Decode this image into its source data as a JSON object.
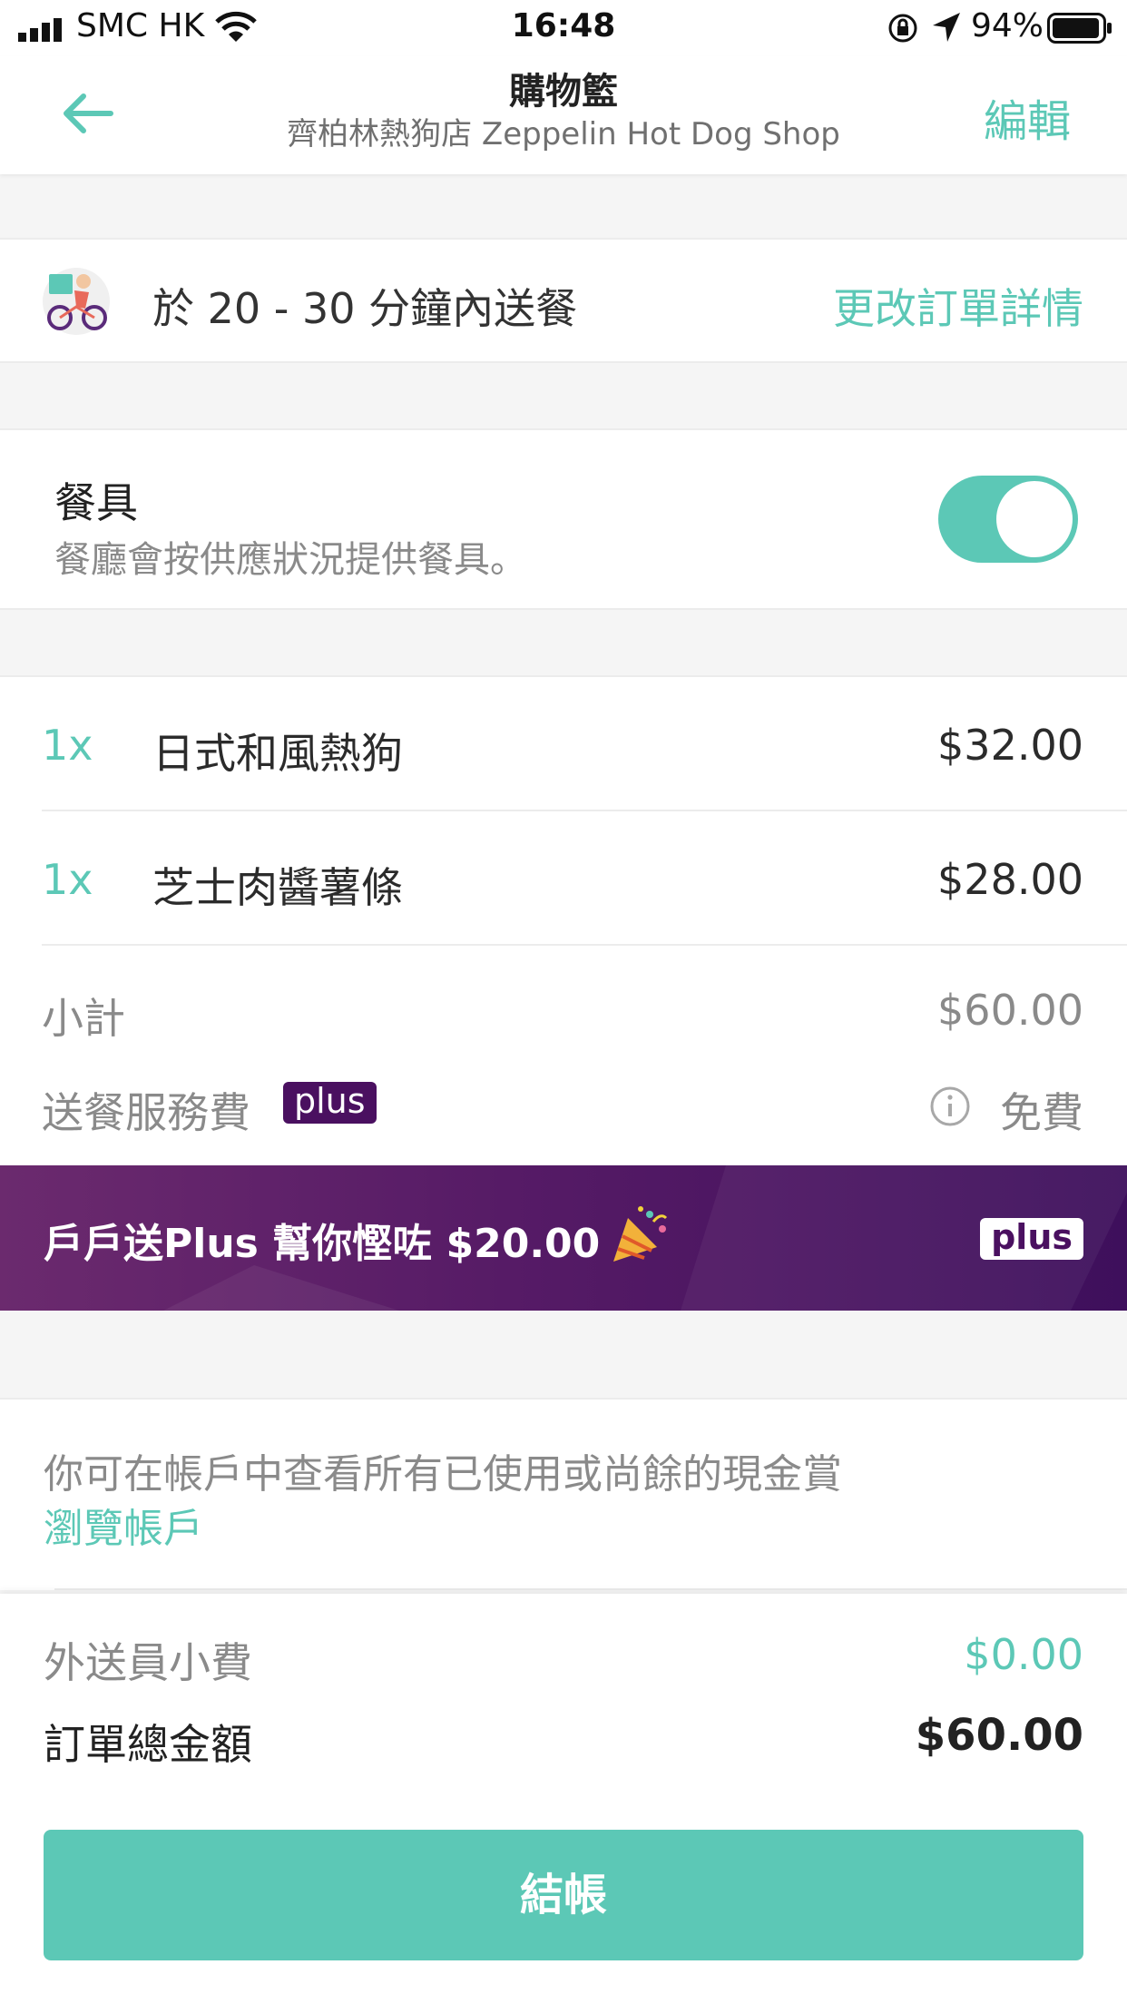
{
  "status_bar": {
    "carrier": "SMC HK",
    "time": "16:48",
    "battery": "94%"
  },
  "header": {
    "title": "購物籃",
    "subtitle": "齊柏林熱狗店 Zeppelin Hot Dog Shop",
    "edit_label": "編輯"
  },
  "delivery": {
    "text": "於 20 - 30 分鐘內送餐",
    "change_label": "更改訂單詳情"
  },
  "cutlery": {
    "title": "餐具",
    "description": "餐廳會按供應狀況提供餐具。",
    "enabled": true
  },
  "items": [
    {
      "qty": "1x",
      "name": "日式和風熱狗",
      "price": "$32.00"
    },
    {
      "qty": "1x",
      "name": "芝士肉醬薯條",
      "price": "$28.00"
    }
  ],
  "summary": {
    "subtotal_label": "小計",
    "subtotal_value": "$60.00",
    "delivery_fee_label": "送餐服務費",
    "plus_badge": "plus",
    "delivery_fee_value": "免費"
  },
  "promo": {
    "text": "戶戶送Plus 幫你慳咗 $20.00",
    "badge": "plus"
  },
  "cashback": {
    "text": "你可在帳戶中查看所有已使用或尚餘的現金賞",
    "link": "瀏覽帳戶"
  },
  "footer": {
    "tip_label": "外送員小費",
    "tip_value": "$0.00",
    "total_label": "訂單總金額",
    "total_value": "$60.00",
    "checkout_label": "結帳"
  },
  "colors": {
    "accent": "#5cc8b6",
    "plus_purple": "#4a1060"
  }
}
